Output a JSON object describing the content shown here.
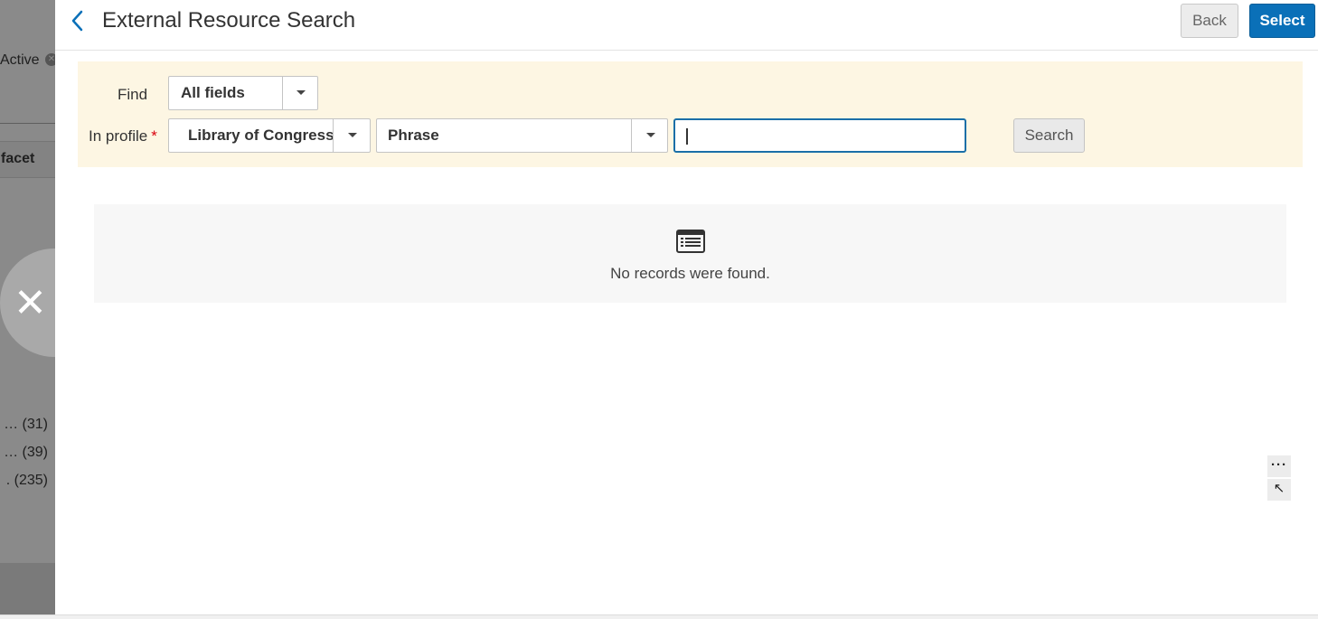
{
  "background": {
    "active_filter_label": "Active",
    "facet_label": "facet",
    "facet_counts": [
      {
        "prefix": "' …",
        "count": "(31)"
      },
      {
        "prefix": "…",
        "count": "(39)"
      },
      {
        "prefix": ".",
        "count": "(235)"
      }
    ],
    "close_glyph": "✕"
  },
  "header": {
    "title": "External Resource Search",
    "back_label": "Back",
    "select_label": "Select"
  },
  "search": {
    "find_label": "Find",
    "find_value": "All fields",
    "profile_label": "In profile",
    "required_marker": "*",
    "profile_value": "Library of Congress",
    "match_value": "Phrase",
    "query_value": "",
    "search_label": "Search"
  },
  "results": {
    "empty_message": "No records were found."
  },
  "tools": {
    "more_glyph": "···",
    "arrow_glyph": "↖"
  },
  "colors": {
    "primary": "#0a70b8",
    "search_bg": "#fdf6e3",
    "required": "#d9000d",
    "overlay": "#8a8a8a"
  }
}
